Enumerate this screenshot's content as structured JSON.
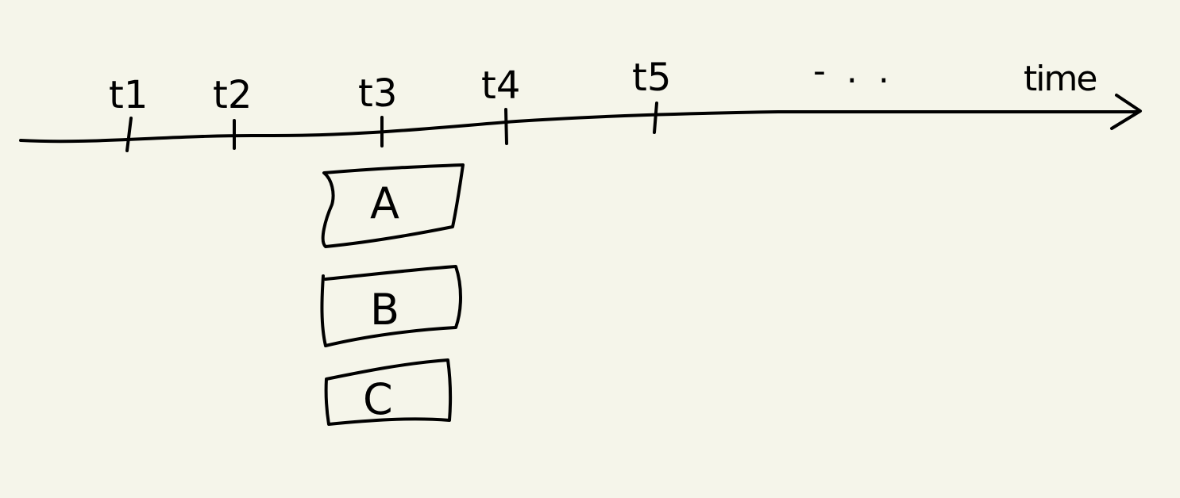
{
  "diagram": {
    "axis_label": "time",
    "ellipsis": "- . .",
    "ticks": [
      "t1",
      "t2",
      "t3",
      "t4",
      "t5"
    ],
    "boxes": [
      "A",
      "B",
      "C"
    ]
  },
  "colors": {
    "background": "#f5f5ea",
    "ink": "#000000"
  }
}
